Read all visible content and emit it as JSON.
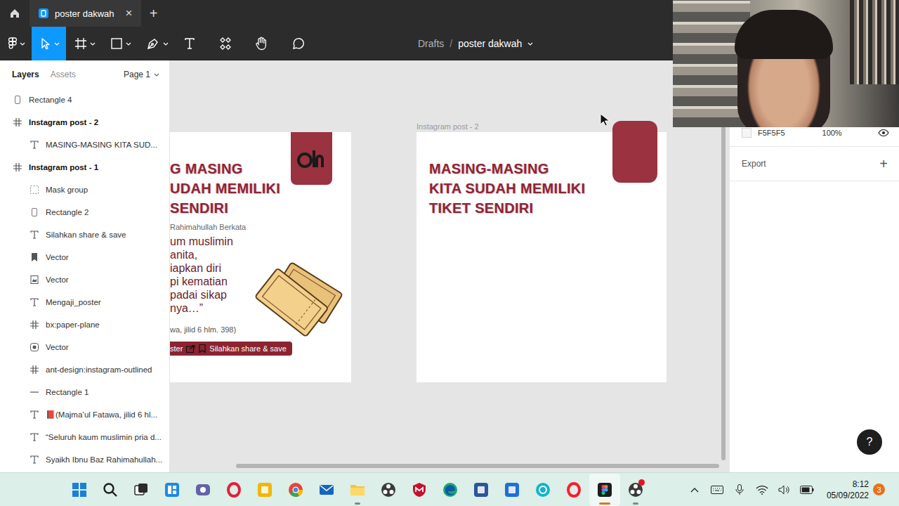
{
  "tabbar": {
    "tabs": [
      {
        "label": "poster dakwah",
        "close": "×",
        "selected": true
      }
    ],
    "new_tab": "+"
  },
  "toolbar": {
    "tools": [
      {
        "kind": "main-menu",
        "dropdown": true,
        "selected": false
      },
      {
        "kind": "move",
        "dropdown": true,
        "selected": true
      },
      {
        "kind": "frame",
        "dropdown": true,
        "selected": false
      },
      {
        "kind": "shape",
        "dropdown": true,
        "selected": false
      },
      {
        "kind": "pen",
        "dropdown": true,
        "selected": false
      },
      {
        "kind": "text",
        "dropdown": false,
        "selected": false
      },
      {
        "kind": "resources",
        "dropdown": false,
        "selected": false
      },
      {
        "kind": "hand",
        "dropdown": false,
        "selected": false
      },
      {
        "kind": "comment",
        "dropdown": false,
        "selected": false
      }
    ],
    "breadcrumb": {
      "parent": "Drafts",
      "separator": "/",
      "file": "poster dakwah"
    }
  },
  "layers_panel": {
    "tabs": [
      {
        "label": "Layers",
        "selected": true
      },
      {
        "label": "Assets",
        "selected": false
      }
    ],
    "page": "Page 1",
    "layers": [
      {
        "name": "Rectangle 4",
        "kind": "rectangle",
        "depth": 0
      },
      {
        "name": "Instagram post - 2",
        "kind": "frame",
        "depth": 0
      },
      {
        "name": "MASING-MASING KITA SUD...",
        "kind": "text",
        "depth": 1
      },
      {
        "name": "Instagram post - 1",
        "kind": "frame",
        "depth": 0
      },
      {
        "name": "Mask group",
        "kind": "mask",
        "depth": 1
      },
      {
        "name": "Rectangle 2",
        "kind": "rectangle",
        "depth": 1
      },
      {
        "name": "Silahkan share & save",
        "kind": "text",
        "depth": 1
      },
      {
        "name": "Vector",
        "kind": "bookmark",
        "depth": 1
      },
      {
        "name": "Vector",
        "kind": "image",
        "depth": 1
      },
      {
        "name": "Mengaji_poster",
        "kind": "text",
        "depth": 1
      },
      {
        "name": "bx:paper-plane",
        "kind": "frame",
        "depth": 1
      },
      {
        "name": "Vector",
        "kind": "instagram",
        "depth": 1
      },
      {
        "name": "ant-design:instagram-outlined",
        "kind": "frame",
        "depth": 1
      },
      {
        "name": "Rectangle 1",
        "kind": "line",
        "depth": 1
      },
      {
        "name": "📕(Majma’ul Fatawa, jilid 6 hl...",
        "kind": "text",
        "depth": 1
      },
      {
        "name": "“Seluruh kaum muslimin pria d...",
        "kind": "text",
        "depth": 1
      },
      {
        "name": "Syaikh Ibnu Baz Rahimahullah...",
        "kind": "text",
        "depth": 1
      }
    ]
  },
  "canvas": {
    "post_1": {
      "title_lines": [
        "G MASING",
        "UDAH MEMILIKI",
        "SENDIRI"
      ],
      "subtitle": "Rahimahullah Berkata",
      "quote_lines": [
        "um muslimin",
        "anita,",
        "iapkan diri",
        "pi kematian",
        "padai sikap",
        "nya…”"
      ],
      "source": "wa, jilid 6 hlm. 398)",
      "footer_left": "ster",
      "footer_right": "Silahkan share & save"
    },
    "post_2": {
      "label": "Instagram post - 2",
      "title_lines": [
        "MASING-MASING",
        "KITA SUDAH MEMILIKI",
        "TIKET SENDIRI"
      ]
    }
  },
  "design_panel": {
    "fill": {
      "hex": "F5F5F5",
      "opacity": "100%",
      "visible": true
    },
    "export": {
      "label": "Export",
      "add": "+"
    }
  },
  "help": "?",
  "taskbar": {
    "apps": [
      {
        "kind": "start",
        "color": "#1b7fd6",
        "running": false,
        "active": false,
        "alert": false
      },
      {
        "kind": "search",
        "color": "#1f1f1f",
        "running": false,
        "active": false,
        "alert": false
      },
      {
        "kind": "task",
        "color": "#2b2b2b",
        "running": false,
        "active": false,
        "alert": false
      },
      {
        "kind": "widgets",
        "color": "#1e88e5",
        "running": false,
        "active": false,
        "alert": false
      },
      {
        "kind": "teams",
        "color": "#6264a7",
        "running": false,
        "active": false,
        "alert": false
      },
      {
        "kind": "ring",
        "color": "#e2203a",
        "running": false,
        "active": false,
        "alert": false
      },
      {
        "kind": "tile",
        "color": "#f2b705",
        "running": false,
        "active": false,
        "alert": false
      },
      {
        "kind": "chrome",
        "color": "#34a853",
        "running": false,
        "active": false,
        "alert": false
      },
      {
        "kind": "mail",
        "color": "#1565c0",
        "running": false,
        "active": false,
        "alert": false
      },
      {
        "kind": "folder",
        "color": "#f4c542",
        "running": true,
        "active": false,
        "alert": false
      },
      {
        "kind": "obs",
        "color": "#3a3a3a",
        "running": false,
        "active": false,
        "alert": false
      },
      {
        "kind": "shield",
        "color": "#c8102e",
        "running": false,
        "active": false,
        "alert": false
      },
      {
        "kind": "edge",
        "color": "#1fa37a",
        "running": false,
        "active": false,
        "alert": false
      },
      {
        "kind": "tile",
        "color": "#2b579a",
        "running": false,
        "active": false,
        "alert": false
      },
      {
        "kind": "tile",
        "color": "#1e6fd9",
        "running": false,
        "active": false,
        "alert": false
      },
      {
        "kind": "circle",
        "color": "#12b5cb",
        "running": false,
        "active": false,
        "alert": false
      },
      {
        "kind": "ring",
        "color": "#ff1b2d",
        "running": false,
        "active": false,
        "alert": false
      },
      {
        "kind": "figma",
        "color": "#1e1e1e",
        "running": true,
        "active": true,
        "alert": false
      },
      {
        "kind": "obs",
        "color": "#3a3a3a",
        "running": true,
        "active": false,
        "alert": true
      }
    ],
    "tray": [
      "chevron",
      "keyboard",
      "mic",
      "wifi",
      "volume",
      "battery"
    ],
    "time": "8:12",
    "date": "05/09/2022",
    "notifications": "3"
  }
}
